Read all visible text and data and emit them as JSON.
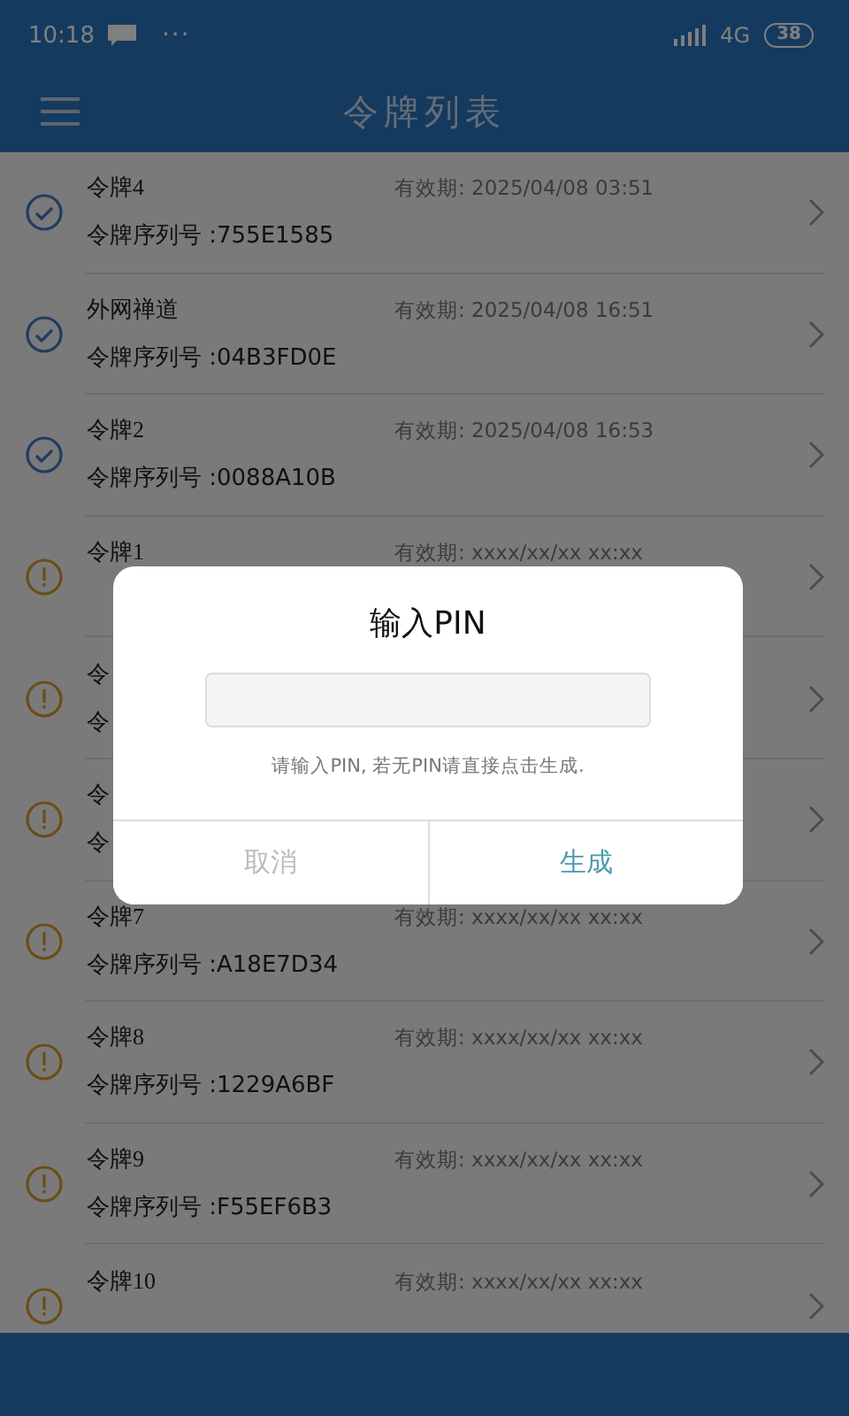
{
  "status_bar": {
    "time": "10:18",
    "dots": "···",
    "network": "4G",
    "battery": "38"
  },
  "header": {
    "title": "令牌列表"
  },
  "tokens": [
    {
      "name": "令牌4",
      "expiry": "有效期: 2025/04/08 03:51",
      "serial": "令牌序列号 :755E1585",
      "kind": "valid"
    },
    {
      "name": "外网禅道",
      "expiry": "有效期: 2025/04/08 16:51",
      "serial": "令牌序列号 :04B3FD0E",
      "kind": "valid"
    },
    {
      "name": "令牌2",
      "expiry": "有效期: 2025/04/08 16:53",
      "serial": "令牌序列号 :0088A10B",
      "kind": "valid"
    },
    {
      "name": "令牌1",
      "expiry": "有效期: xxxx/xx/xx xx:xx",
      "kind": "pending"
    },
    {
      "name": "令",
      "serial": "令",
      "kind": "pending"
    },
    {
      "name": "令",
      "serial": "令",
      "kind": "pending"
    },
    {
      "name": "令牌7",
      "expiry": "有效期: xxxx/xx/xx xx:xx",
      "serial": "令牌序列号 :A18E7D34",
      "kind": "pending"
    },
    {
      "name": "令牌8",
      "expiry": "有效期: xxxx/xx/xx xx:xx",
      "serial": "令牌序列号 :1229A6BF",
      "kind": "pending"
    },
    {
      "name": "令牌9",
      "expiry": "有效期: xxxx/xx/xx xx:xx",
      "serial": "令牌序列号 :F55EF6B3",
      "kind": "pending"
    },
    {
      "name": "令牌10",
      "expiry": "有效期: xxxx/xx/xx xx:xx",
      "kind": "pending"
    }
  ],
  "dialog": {
    "title": "输入PIN",
    "hint": "请输入PIN, 若无PIN请直接点击生成.",
    "buttons": [
      {
        "label": "取消",
        "kind": "cancel"
      },
      {
        "label": "生成",
        "kind": "confirm"
      }
    ]
  }
}
